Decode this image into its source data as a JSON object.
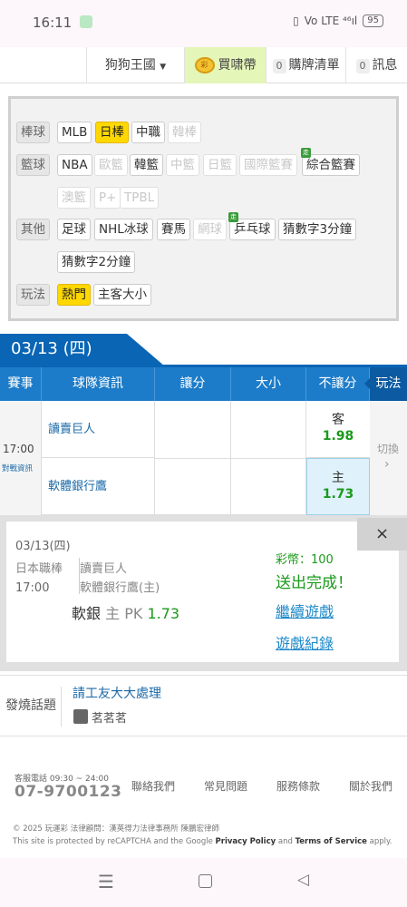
{
  "status_bar": {
    "time": "16:11",
    "signal": "Vo LTE ⁴⁶ıl",
    "battery": "95"
  },
  "top_nav": {
    "kingdom": "狗狗王國",
    "coin_icon_text": "彩",
    "buy_coins": "買啸帶",
    "cart_count": "0",
    "cart": "購牌清單",
    "msg_count": "0",
    "messages": "訊息"
  },
  "filters": {
    "baseball": {
      "label": "棒球",
      "items": [
        "MLB",
        "日棒",
        "中職",
        "韓棒"
      ]
    },
    "basketball": {
      "label": "籃球",
      "items": [
        "NBA",
        "歐籃",
        "韓籃",
        "中籃",
        "日籃",
        "國際籃賽",
        "綜合籃賽",
        "澳籃",
        "P+",
        "TPBL"
      ]
    },
    "other": {
      "label": "其他",
      "items": [
        "足球",
        "NHL冰球",
        "賽馬",
        "網球",
        "乒乓球",
        "猜數字3分鐘",
        "猜數字2分鐘"
      ]
    },
    "play": {
      "label": "玩法",
      "items": [
        "熱門",
        "主客大小"
      ]
    },
    "new_badge": "走"
  },
  "date_tab": "03/13 (四)",
  "table": {
    "headers": [
      "賽事",
      "球隊資訊",
      "讓分",
      "大小",
      "不讓分",
      "玩法"
    ],
    "time": "17:00",
    "matchup_link": "對戰資訊",
    "away_team": "讀賣巨人",
    "home_team": "軟體銀行鷹",
    "away_label": "客",
    "away_odds": "1.98",
    "home_label": "主",
    "home_odds": "1.73",
    "switch": "切換"
  },
  "bet_slip": {
    "date": "03/13(四)",
    "league": "日本職棒",
    "time": "17:00",
    "team1": "讀賣巨人",
    "team2": "軟體銀行鷹(主)",
    "pick_team": "軟銀",
    "pick_side": "主",
    "pick_type": "PK",
    "pick_odds": "1.73",
    "coins_label": "彩幣：",
    "coins_value": "100",
    "success": "送出完成！",
    "continue": "繼續遊戲",
    "history": "遊戲紀錄",
    "close": "×"
  },
  "hot_topic": {
    "label": "發燒話題",
    "title": "請工友大大處理",
    "author": "茗茗茗"
  },
  "footer": {
    "hours": "客服電話 09:30 ~ 24:00",
    "phone": "07-9700123",
    "links": [
      "聯絡我們",
      "常見問題",
      "服務條款",
      "關於我們"
    ],
    "copyright": "© 2025 玩運彩 法律顧問：漢英得力法律事務所 陳鵬宏律師",
    "recaptcha_pre": "This site is protected by reCAPTCHA and the Google",
    "privacy": "Privacy Policy",
    "and": "and",
    "terms": "Terms of Service",
    "apply": "apply."
  }
}
